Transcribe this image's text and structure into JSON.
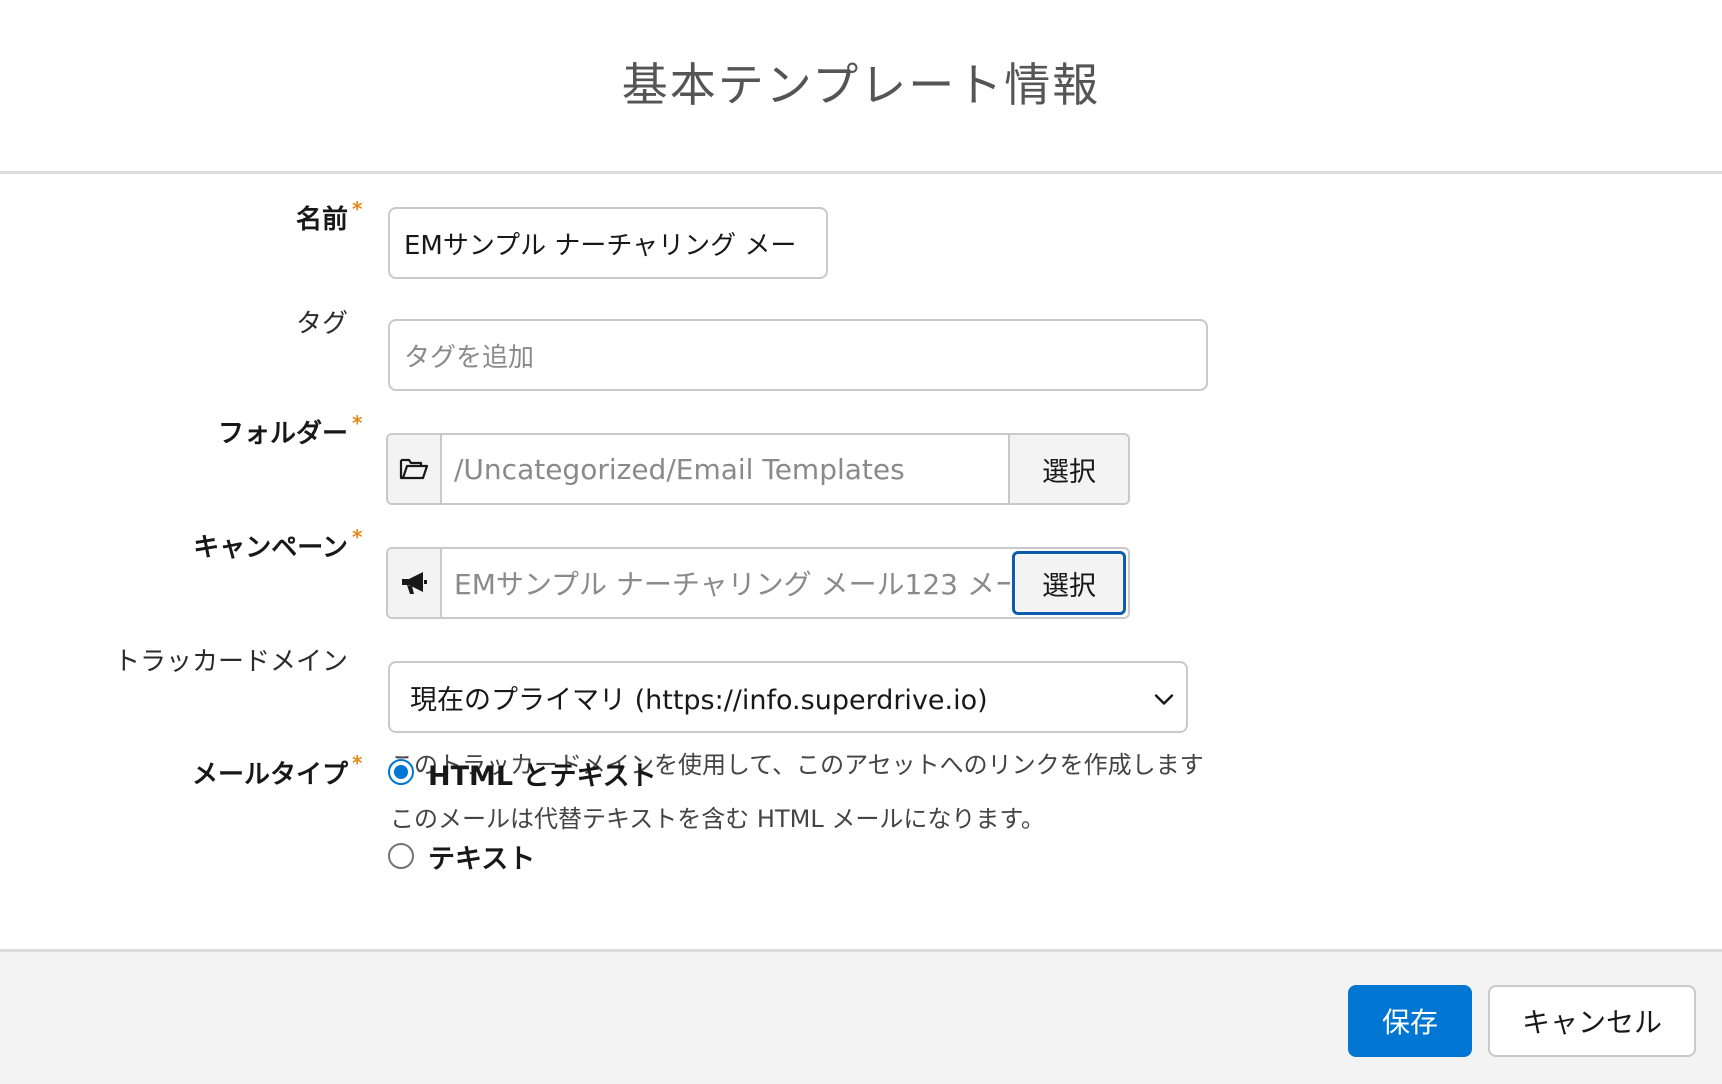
{
  "modal": {
    "title": "基本テンプレート情報"
  },
  "form": {
    "name": {
      "label": "名前",
      "required_mark": "*",
      "value": "EMサンプル ナーチャリング メー"
    },
    "tags": {
      "label": "タグ",
      "placeholder": "タグを追加"
    },
    "folder": {
      "label": "フォルダー",
      "required_mark": "*",
      "icon": "folder-open-icon",
      "value": "/Uncategorized/Email Templates",
      "button_label": "選択"
    },
    "campaign": {
      "label": "キャンペーン",
      "required_mark": "*",
      "icon": "megaphone-icon",
      "value": "EMサンプル ナーチャリング メール123 メー",
      "button_label": "選択"
    },
    "tracker_domain": {
      "label": "トラッカードメイン",
      "selected": "現在のプライマリ (https://info.superdrive.io)",
      "help": "このトラッカードメインを使用して、このアセットへのリンクを作成します"
    },
    "email_type": {
      "label": "メールタイプ",
      "required_mark": "*",
      "options": [
        {
          "label": "HTML とテキスト",
          "description": "このメールは代替テキストを含む HTML メールになります。",
          "checked": true
        },
        {
          "label": "テキスト",
          "checked": false
        }
      ]
    }
  },
  "footer": {
    "save_label": "保存",
    "cancel_label": "キャンセル"
  },
  "colors": {
    "brand": "#0176d3",
    "required": "#e58a1a",
    "focus_border": "#0b5cab"
  }
}
